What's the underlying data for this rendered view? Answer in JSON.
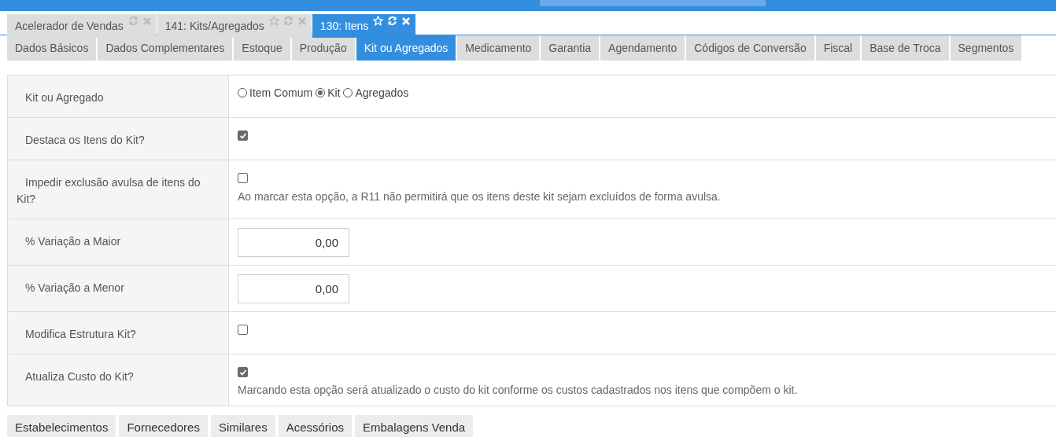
{
  "doc_tabs": [
    {
      "label": "Acelerador de Vendas",
      "selected": false,
      "starrable": false
    },
    {
      "label": "141: Kits/Agregados",
      "selected": false,
      "starrable": true
    },
    {
      "label": "130: Itens",
      "selected": true,
      "starrable": true
    }
  ],
  "section_tabs": [
    {
      "label": "Dados Básicos",
      "selected": false
    },
    {
      "label": "Dados Complementares",
      "selected": false
    },
    {
      "label": "Estoque",
      "selected": false
    },
    {
      "label": "Produção",
      "selected": false
    },
    {
      "label": "Kit ou Agregados",
      "selected": true
    },
    {
      "label": "Medicamento",
      "selected": false
    },
    {
      "label": "Garantia",
      "selected": false
    },
    {
      "label": "Agendamento",
      "selected": false
    },
    {
      "label": "Códigos de Conversão",
      "selected": false
    },
    {
      "label": "Fiscal",
      "selected": false
    },
    {
      "label": "Base de Troca",
      "selected": false
    },
    {
      "label": "Segmentos",
      "selected": false
    }
  ],
  "fields": [
    {
      "label": "Kit ou Agregado",
      "kind": "radio",
      "options": [
        {
          "label": "Item Comum",
          "selected": false
        },
        {
          "label": "Kit",
          "selected": true
        },
        {
          "label": "Agregados",
          "selected": false
        }
      ]
    },
    {
      "label": "Destaca os Itens do Kit?",
      "kind": "checkbox",
      "checked": true
    },
    {
      "label": "Impedir exclusão avulsa de itens do Kit?",
      "kind": "checkbox",
      "checked": false,
      "help": "Ao marcar esta opção, a R11 não permitirá que os itens deste kit sejam excluídos de forma avulsa."
    },
    {
      "label": "% Variação a Maior",
      "kind": "number",
      "value": "0,00"
    },
    {
      "label": "% Variação a Menor",
      "kind": "number",
      "value": "0,00"
    },
    {
      "label": "Modifica Estrutura Kit?",
      "kind": "checkbox",
      "checked": false
    },
    {
      "label": "Atualiza Custo do Kit?",
      "kind": "checkbox",
      "checked": true,
      "help": "Marcando esta opção será atualizado o custo do kit conforme os custos cadastrados nos itens que compõem o kit."
    }
  ],
  "bottom_buttons": [
    "Estabelecimentos",
    "Fornecedores",
    "Similares",
    "Acessórios",
    "Embalagens Venda"
  ]
}
